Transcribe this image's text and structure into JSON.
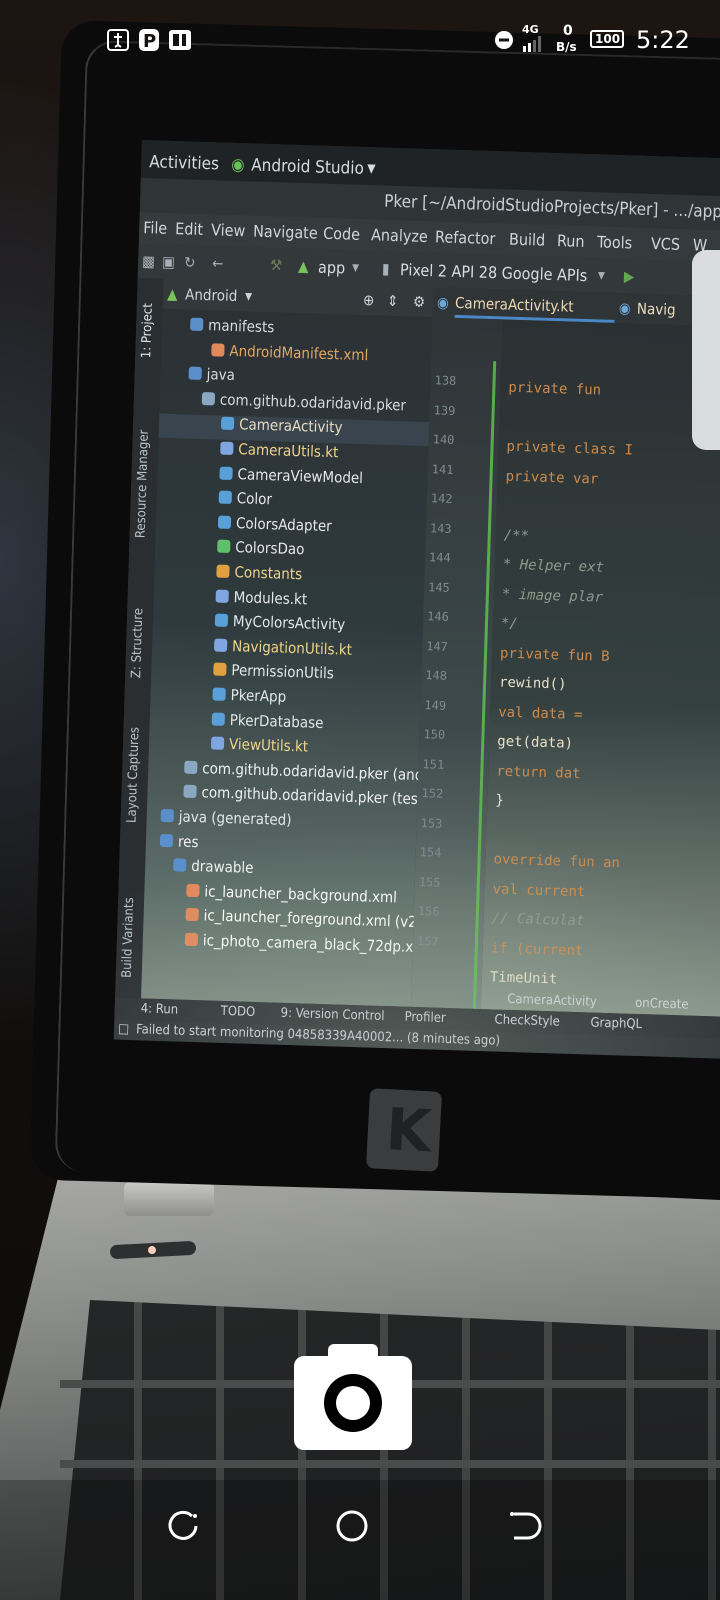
{
  "status_bar": {
    "time": "5:22",
    "network_type": "4G",
    "data_rate_value": "0",
    "data_rate_unit": "B/s",
    "battery": "100",
    "left_icons": [
      "usb-icon",
      "parking-icon",
      "app-icon"
    ],
    "right_icons": [
      "dnd-icon",
      "signal-icon",
      "battery-icon"
    ]
  },
  "ide": {
    "activities": "Activities",
    "app_menu": "Android Studio",
    "window_title": "Pker [~/AndroidStudioProjects/Pker] - .../app",
    "menu": [
      "File",
      "Edit",
      "View",
      "Navigate",
      "Code",
      "Analyze",
      "Refactor",
      "Build",
      "Run",
      "Tools",
      "VCS",
      "W"
    ],
    "toolbar": {
      "run_config": "app",
      "device": "Pixel 2 API 28 Google APIs"
    },
    "side_tabs": [
      "1: Project",
      "Resource Manager",
      "Z: Structure",
      "Layout Captures",
      "Build Variants"
    ],
    "project_view": "Android",
    "tabs": [
      {
        "label": "CameraActivity.kt",
        "active": true
      },
      {
        "label": "Navig",
        "active": false
      }
    ],
    "tree": [
      {
        "label": "manifests",
        "kind": "folder",
        "color": "#d6dde1"
      },
      {
        "label": "AndroidManifest.xml",
        "kind": "xml",
        "color": "#e0a860"
      },
      {
        "label": "java",
        "kind": "folder",
        "color": "#d6dde1"
      },
      {
        "label": "com.github.odaridavid.pker",
        "kind": "package",
        "color": "#d6dde1"
      },
      {
        "label": "CameraActivity",
        "kind": "class",
        "color": "#e8dcc0"
      },
      {
        "label": "CameraUtils.kt",
        "kind": "kotlin",
        "color": "#f0d48a"
      },
      {
        "label": "CameraViewModel",
        "kind": "class",
        "color": "#e3e8ea"
      },
      {
        "label": "Color",
        "kind": "class",
        "color": "#e3e8ea"
      },
      {
        "label": "ColorsAdapter",
        "kind": "class",
        "color": "#e3e8ea"
      },
      {
        "label": "ColorsDao",
        "kind": "interface",
        "color": "#e3e8ea"
      },
      {
        "label": "Constants",
        "kind": "object",
        "color": "#f0d48a"
      },
      {
        "label": "Modules.kt",
        "kind": "kotlin",
        "color": "#e3e8ea"
      },
      {
        "label": "MyColorsActivity",
        "kind": "class",
        "color": "#e3e8ea"
      },
      {
        "label": "NavigationUtils.kt",
        "kind": "kotlin",
        "color": "#f0d48a"
      },
      {
        "label": "PermissionUtils",
        "kind": "object",
        "color": "#e3e8ea"
      },
      {
        "label": "PkerApp",
        "kind": "class",
        "color": "#e3e8ea"
      },
      {
        "label": "PkerDatabase",
        "kind": "class",
        "color": "#e3e8ea"
      },
      {
        "label": "ViewUtils.kt",
        "kind": "kotlin",
        "color": "#f0d48a"
      },
      {
        "label": "com.github.odaridavid.pker (andro",
        "kind": "package",
        "color": "#eef2f0"
      },
      {
        "label": "com.github.odaridavid.pker (test)",
        "kind": "package",
        "color": "#eef2f0"
      },
      {
        "label": "java (generated)",
        "kind": "folder",
        "color": "#e3e8ea"
      },
      {
        "label": "res",
        "kind": "folder",
        "color": "#eef2f0"
      },
      {
        "label": "drawable",
        "kind": "folder",
        "color": "#eef2f0"
      },
      {
        "label": "ic_launcher_background.xml",
        "kind": "xml",
        "color": "#ffffff"
      },
      {
        "label": "ic_launcher_foreground.xml (v24",
        "kind": "xml",
        "color": "#ffffff"
      },
      {
        "label": "ic_photo_camera_black_72dp.xm",
        "kind": "xml",
        "color": "#ffffff"
      }
    ],
    "line_numbers": [
      "138",
      "139",
      "140",
      "141",
      "142",
      "143",
      "144",
      "145",
      "146",
      "147",
      "148",
      "149",
      "150",
      "151",
      "152",
      "153",
      "154",
      "155",
      "156",
      "157"
    ],
    "code_lines": [
      {
        "text": "private fun",
        "cls": "kw"
      },
      {
        "text": "",
        "cls": "pl"
      },
      {
        "text": "private class I",
        "cls": "kw"
      },
      {
        "text": "  private var",
        "cls": "kw"
      },
      {
        "text": "",
        "cls": "pl"
      },
      {
        "text": "  /**",
        "cls": "cm"
      },
      {
        "text": "   * Helper ext",
        "cls": "cm"
      },
      {
        "text": "   * image plar",
        "cls": "cm"
      },
      {
        "text": "   */",
        "cls": "cm"
      },
      {
        "text": "  private fun B",
        "cls": "kw"
      },
      {
        "text": "    rewind()",
        "cls": "fn"
      },
      {
        "text": "    val data =",
        "cls": "kw"
      },
      {
        "text": "    get(data)",
        "cls": "fn"
      },
      {
        "text": "    return dat",
        "cls": "kw"
      },
      {
        "text": "  }",
        "cls": "pl"
      },
      {
        "text": "",
        "cls": "pl"
      },
      {
        "text": "override fun an",
        "cls": "kw"
      },
      {
        "text": "    val current",
        "cls": "kw"
      },
      {
        "text": "    // Calculat",
        "cls": "cm"
      },
      {
        "text": "    if (current",
        "cls": "kw"
      },
      {
        "text": "      TimeUnit",
        "cls": "fn"
      }
    ],
    "tool_windows": [
      "4: Run",
      "TODO",
      "9: Version Control",
      "Profiler",
      "CheckStyle",
      "GraphQL"
    ],
    "breadcrumb": [
      "CameraActivity",
      "onCreate"
    ],
    "status_message": "Failed to start monitoring 04858339A40002... (8 minutes ago)"
  },
  "camera": {
    "shutter": "camera-shutter-button"
  },
  "navigation": [
    "recent-apps-icon",
    "home-icon",
    "back-icon"
  ]
}
